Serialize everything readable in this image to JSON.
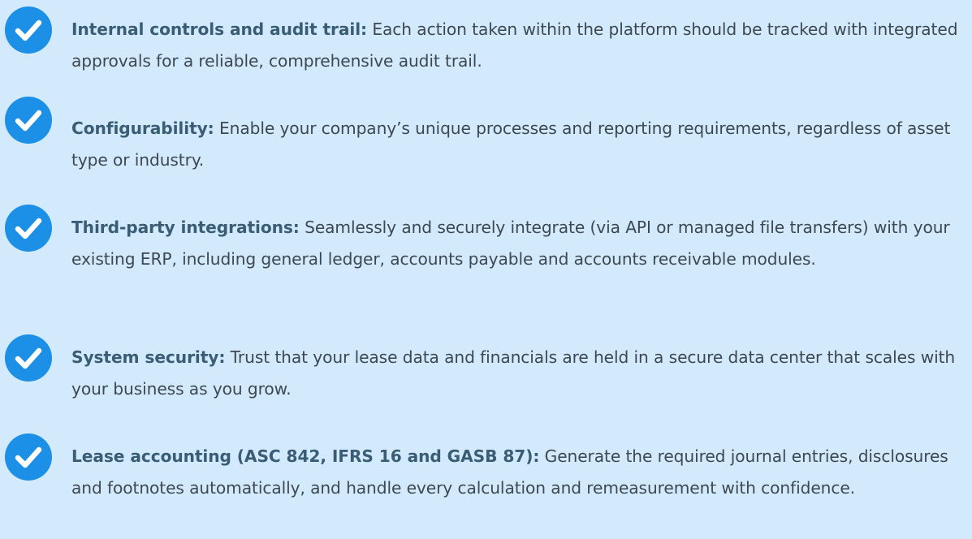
{
  "items": [
    {
      "icon": "check-circle-icon",
      "title": "Internal controls and audit trail:",
      "body": "Each action taken within the platform should be tracked with integrated approvals for a reliable, comprehensive audit trail."
    },
    {
      "icon": "check-circle-icon",
      "title": "Configurability:",
      "body": "Enable your company’s unique processes and reporting requirements, regardless of asset type or industry."
    },
    {
      "icon": "check-circle-icon",
      "title": "Third-party integrations:",
      "body": "Seamlessly and securely integrate (via API or managed file transfers) with your existing ERP, including general ledger, accounts payable and accounts receivable modules."
    },
    {
      "icon": "check-circle-icon",
      "title": "System security:",
      "body": "Trust that your lease data and financials are held in a secure data center that scales with your business as you grow."
    },
    {
      "icon": "check-circle-icon",
      "title": "Lease accounting (ASC 842, IFRS 16 and GASB 87):",
      "body": "Generate the required journal entries, disclosures and footnotes automatically, and handle every calculation and remeasurement with confidence."
    }
  ],
  "colors": {
    "background": "#d2eafb",
    "check_circle": "#1c8fe6",
    "title_text": "#3a5d75",
    "body_text": "#3d4852"
  }
}
